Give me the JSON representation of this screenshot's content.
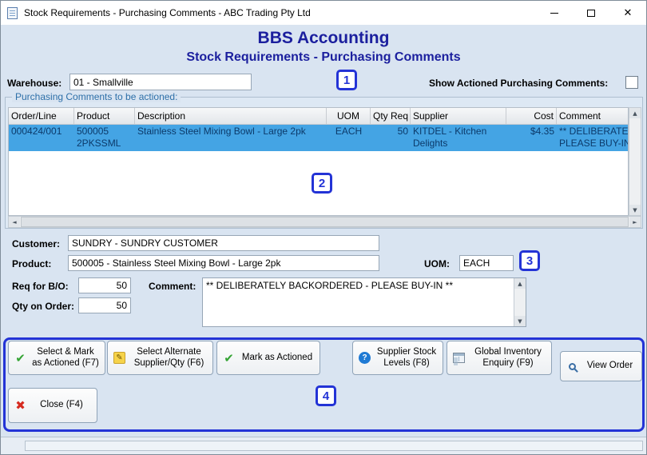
{
  "window": {
    "title": "Stock Requirements - Purchasing Comments - ABC Trading Pty Ltd",
    "close_glyph": "✕"
  },
  "header": {
    "app_title": "BBS Accounting",
    "screen_title": "Stock Requirements - Purchasing Comments"
  },
  "warehouse": {
    "label": "Warehouse:",
    "value": "01 - Smallville"
  },
  "show_actioned": {
    "label": "Show Actioned Purchasing Comments:",
    "checked": false
  },
  "grid": {
    "group_label": "Purchasing Comments to be actioned:",
    "columns": [
      "Order/Line",
      "Product",
      "Description",
      "UOM",
      "Qty Req",
      "Supplier",
      "Cost",
      "Comment"
    ],
    "rows": [
      {
        "order_line": "000424/001",
        "product": "500005 2PKSSML",
        "description": "Stainless Steel Mixing Bowl - Large 2pk",
        "uom": "EACH",
        "qty_req": "50",
        "supplier": "KITDEL - Kitchen Delights",
        "cost": "$4.35",
        "comment": "** DELIBERATELY BACKORDERED - PLEASE BUY-IN **"
      }
    ]
  },
  "details": {
    "customer_label": "Customer:",
    "customer": "SUNDRY - SUNDRY CUSTOMER",
    "product_label": "Product:",
    "product": "500005 - Stainless Steel Mixing Bowl - Large 2pk",
    "uom_label": "UOM:",
    "uom": "EACH",
    "req_bo_label": "Req for B/O:",
    "req_bo": "50",
    "qty_on_order_label": "Qty on Order:",
    "qty_on_order": "50",
    "comment_label": "Comment:",
    "comment": "** DELIBERATELY BACKORDERED - PLEASE BUY-IN **"
  },
  "buttons": {
    "select_mark_actioned": "Select & Mark as Actioned (F7)",
    "select_alternate": "Select Alternate Supplier/Qty (F6)",
    "mark_actioned": "Mark as Actioned",
    "supplier_stock": "Supplier Stock Levels (F8)",
    "global_inventory": "Global Inventory Enquiry (F9)",
    "view_order": "View Order",
    "close": "Close (F4)"
  },
  "annotations": {
    "n1": "1",
    "n2": "2",
    "n3": "3",
    "n4": "4"
  },
  "icons": {
    "check": "✔",
    "pencil": "✎",
    "question": "?",
    "close_x": "✖",
    "up": "▲",
    "down": "▼",
    "left": "◄",
    "right": "►"
  },
  "colors": {
    "accent_navy": "#1b1f9e",
    "group_label_blue": "#2d6fa8",
    "annotation_blue": "#2333d6",
    "selected_row_bg": "#44a4e4",
    "selected_row_text": "#0c3a6a",
    "content_bg": "#d9e4f1"
  }
}
